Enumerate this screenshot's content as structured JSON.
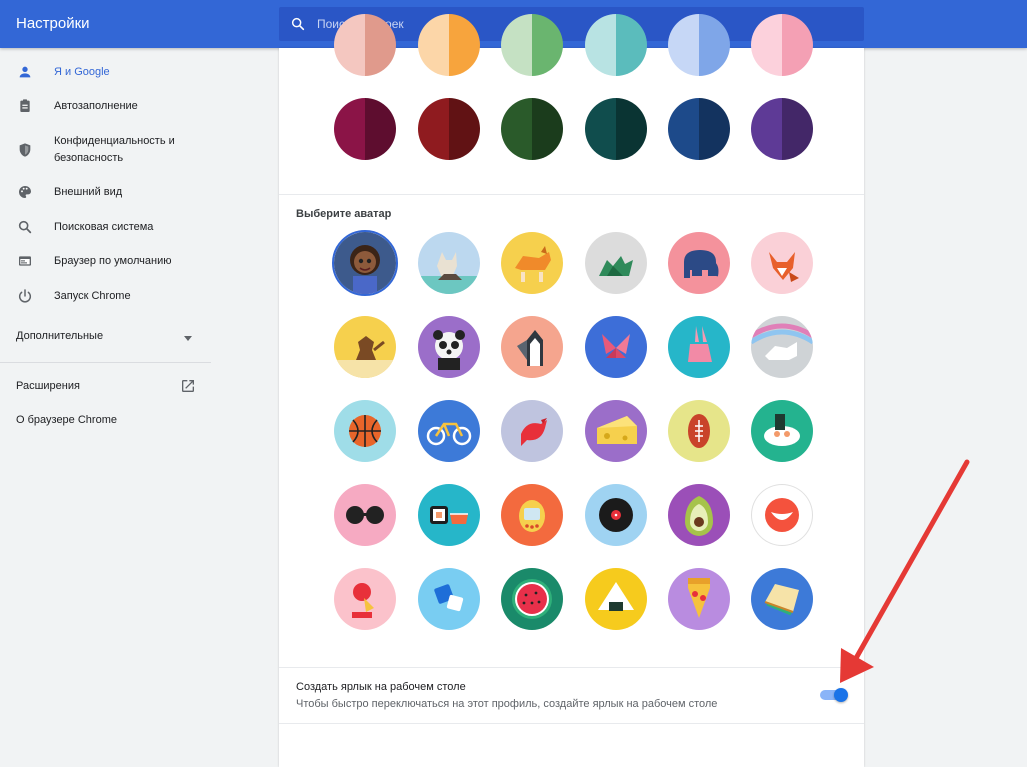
{
  "header": {
    "title": "Настройки",
    "search_placeholder": "Поиск настроек"
  },
  "sidebar": {
    "items": [
      {
        "label": "Я и Google",
        "icon": "person-icon",
        "active": true
      },
      {
        "label": "Автозаполнение",
        "icon": "clipboard-icon"
      },
      {
        "label": "Конфиденциальность и безопасность",
        "icon": "shield-icon"
      },
      {
        "label": "Внешний вид",
        "icon": "palette-icon"
      },
      {
        "label": "Поисковая система",
        "icon": "search-icon"
      },
      {
        "label": "Браузер по умолчанию",
        "icon": "browser-window-icon"
      },
      {
        "label": "Запуск Chrome",
        "icon": "power-icon"
      }
    ],
    "advanced_label": "Дополнительные",
    "extensions_label": "Расширения",
    "about_label": "О браузере Chrome"
  },
  "main": {
    "avatar_section_title": "Выберите аватар",
    "shortcut_title": "Создать ярлык на рабочем столе",
    "shortcut_subtitle": "Чтобы быстро переключаться на этот профиль, создайте ярлык на рабочем столе",
    "shortcut_enabled": true
  },
  "colors": {
    "accent": "#3367d6",
    "swatches_light": [
      [
        "#f4c7c0",
        "#e09a8c"
      ],
      [
        "#fcd6a8",
        "#f7a43d"
      ],
      [
        "#c5e1c3",
        "#6ab56f"
      ],
      [
        "#b8e3e3",
        "#5bbcbc"
      ],
      [
        "#c6d7f6",
        "#7fa6e8"
      ],
      [
        "#fcd1dc",
        "#f4a0b4"
      ]
    ],
    "swatches_dark": [
      [
        "#8b1447",
        "#5e0d2f"
      ],
      [
        "#8f1b1f",
        "#611214"
      ],
      [
        "#2a5a2a",
        "#1b3c1c"
      ],
      [
        "#104d4d",
        "#0a3433"
      ],
      [
        "#1d4a8a",
        "#13335f"
      ],
      [
        "#5e3a96",
        "#432768"
      ]
    ]
  },
  "avatars": [
    {
      "name": "avatar-girl-icon",
      "bg": "#3d5a8c"
    },
    {
      "name": "avatar-cat-icon",
      "bg": "#bcd8ef"
    },
    {
      "name": "avatar-corgi-icon",
      "bg": "#f6d04d"
    },
    {
      "name": "avatar-dragon-icon",
      "bg": "#dcdcdc"
    },
    {
      "name": "avatar-elephant-icon",
      "bg": "#f4929c"
    },
    {
      "name": "avatar-fox-icon",
      "bg": "#fad0d7"
    },
    {
      "name": "avatar-monkey-icon",
      "bg": "#f6d04d"
    },
    {
      "name": "avatar-panda-icon",
      "bg": "#9b6ec9"
    },
    {
      "name": "avatar-penguin-icon",
      "bg": "#f5a58e"
    },
    {
      "name": "avatar-butterfly-icon",
      "bg": "#3d6ed8"
    },
    {
      "name": "avatar-rabbit-icon",
      "bg": "#26b6c9"
    },
    {
      "name": "avatar-unicorn-icon",
      "bg": "#cfd3d6"
    },
    {
      "name": "avatar-basketball-icon",
      "bg": "#9fdde8"
    },
    {
      "name": "avatar-bicycle-icon",
      "bg": "#3d7ad8"
    },
    {
      "name": "avatar-bird-icon",
      "bg": "#bfc4df"
    },
    {
      "name": "avatar-cheese-icon",
      "bg": "#9b6ec9"
    },
    {
      "name": "avatar-football-icon",
      "bg": "#e6e58a"
    },
    {
      "name": "avatar-sushi-plate-icon",
      "bg": "#24b38f"
    },
    {
      "name": "avatar-sunglasses-icon",
      "bg": "#f6aac2"
    },
    {
      "name": "avatar-sushi-icon",
      "bg": "#26b6c9"
    },
    {
      "name": "avatar-tamagotchi-icon",
      "bg": "#f36a3e"
    },
    {
      "name": "avatar-vinyl-icon",
      "bg": "#9fd3f2"
    },
    {
      "name": "avatar-avocado-icon",
      "bg": "#9b4fb8"
    },
    {
      "name": "avatar-smile-icon",
      "bg": "#ffffff"
    },
    {
      "name": "avatar-icecream-icon",
      "bg": "#fbc2cb"
    },
    {
      "name": "avatar-ice-icon",
      "bg": "#79cdf2"
    },
    {
      "name": "avatar-watermelon-icon",
      "bg": "#1a8a6a"
    },
    {
      "name": "avatar-onigiri-icon",
      "bg": "#f6cb1d"
    },
    {
      "name": "avatar-pizza-icon",
      "bg": "#b98ce0"
    },
    {
      "name": "avatar-sandwich-icon",
      "bg": "#3d7ad8"
    }
  ]
}
